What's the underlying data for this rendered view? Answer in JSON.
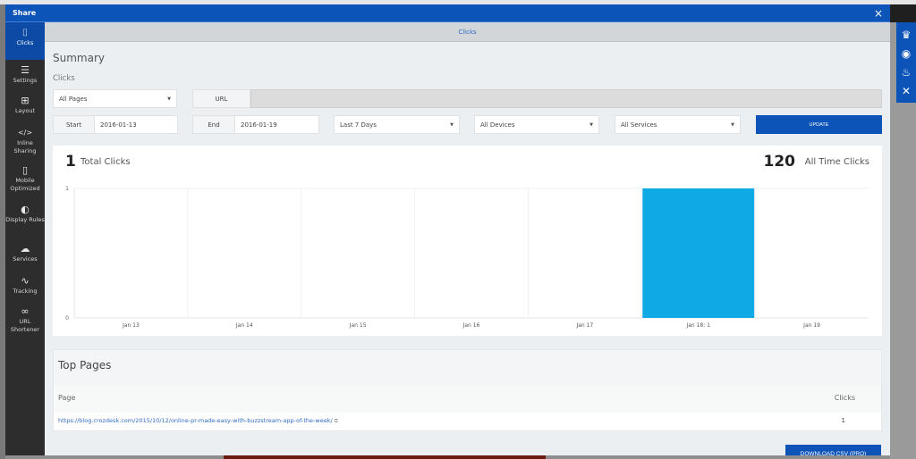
{
  "modal": {
    "title": "Share",
    "close_icon": "×"
  },
  "sidebar": {
    "items": [
      {
        "label": "Clicks",
        "icon": "mouse-icon",
        "glyph": "⌷",
        "active": true
      },
      {
        "label": "Settings",
        "icon": "sliders-icon",
        "glyph": "☰",
        "active": false
      },
      {
        "label": "Layout",
        "icon": "grid-icon",
        "glyph": "⊞",
        "active": false
      },
      {
        "label": "Inline Sharing",
        "icon": "code-icon",
        "glyph": "</>",
        "active": false
      },
      {
        "label": "Mobile Optimized",
        "icon": "mobile-icon",
        "glyph": "▯",
        "active": false
      },
      {
        "label": "Display Rules",
        "icon": "contrast-icon",
        "glyph": "◐",
        "active": false
      },
      {
        "label": "Services",
        "icon": "cloud-upload-icon",
        "glyph": "☁",
        "active": false
      },
      {
        "label": "Tracking",
        "icon": "chart-line-icon",
        "glyph": "∿",
        "active": false
      },
      {
        "label": "URL Shortener",
        "icon": "link-icon",
        "glyph": "∞",
        "active": false
      }
    ]
  },
  "tab": {
    "label": "Clicks"
  },
  "summary": {
    "title": "Summary",
    "subtitle": "Clicks"
  },
  "filters": {
    "pages_select": "All Pages",
    "url_label": "URL",
    "url_value": "",
    "start_label": "Start",
    "start_value": "2016-01-13",
    "end_label": "End",
    "end_value": "2016-01-19",
    "range_select": "Last 7 Days",
    "devices_select": "All Devices",
    "services_select": "All Services",
    "update_label": "UPDATE"
  },
  "stats": {
    "total_clicks": "1",
    "total_clicks_label": "Total Clicks",
    "all_time_clicks": "120",
    "all_time_clicks_label": "All Time Clicks"
  },
  "chart_data": {
    "type": "bar",
    "title": "",
    "xlabel": "",
    "ylabel": "",
    "categories": [
      "Jan 13",
      "Jan 14",
      "Jan 15",
      "Jan 16",
      "Jan 17",
      "Jan 18",
      "Jan 19"
    ],
    "tick_labels": [
      "Jan 13",
      "Jan 14",
      "Jan 15",
      "Jan 16",
      "Jan 17",
      "Jan 18: 1",
      "Jan 19"
    ],
    "values": [
      0,
      0,
      0,
      0,
      0,
      1,
      0
    ],
    "ylim": [
      0,
      1
    ],
    "yticks": [
      "0",
      "1"
    ],
    "grid": true,
    "bar_color": "#0fa9e6"
  },
  "top_pages": {
    "title": "Top Pages",
    "columns": [
      "Page",
      "Clicks"
    ],
    "rows": [
      {
        "page": "https://blog.crozdesk.com/2015/10/12/online-pr-made-easy-with-buzzstream-app-of-the-week/",
        "clicks": "1"
      }
    ]
  },
  "download_label": "DOWNLOAD CSV (PRO)",
  "floating_bar": {
    "icons": [
      "crown-icon",
      "globe-icon",
      "fire-icon",
      "close-icon"
    ],
    "glyphs": [
      "♛",
      "◉",
      "♨",
      "✕"
    ]
  },
  "colors": {
    "brand": "#0d54b8",
    "bar": "#0fa9e6",
    "sidebar_bg": "#2d2d2d"
  }
}
